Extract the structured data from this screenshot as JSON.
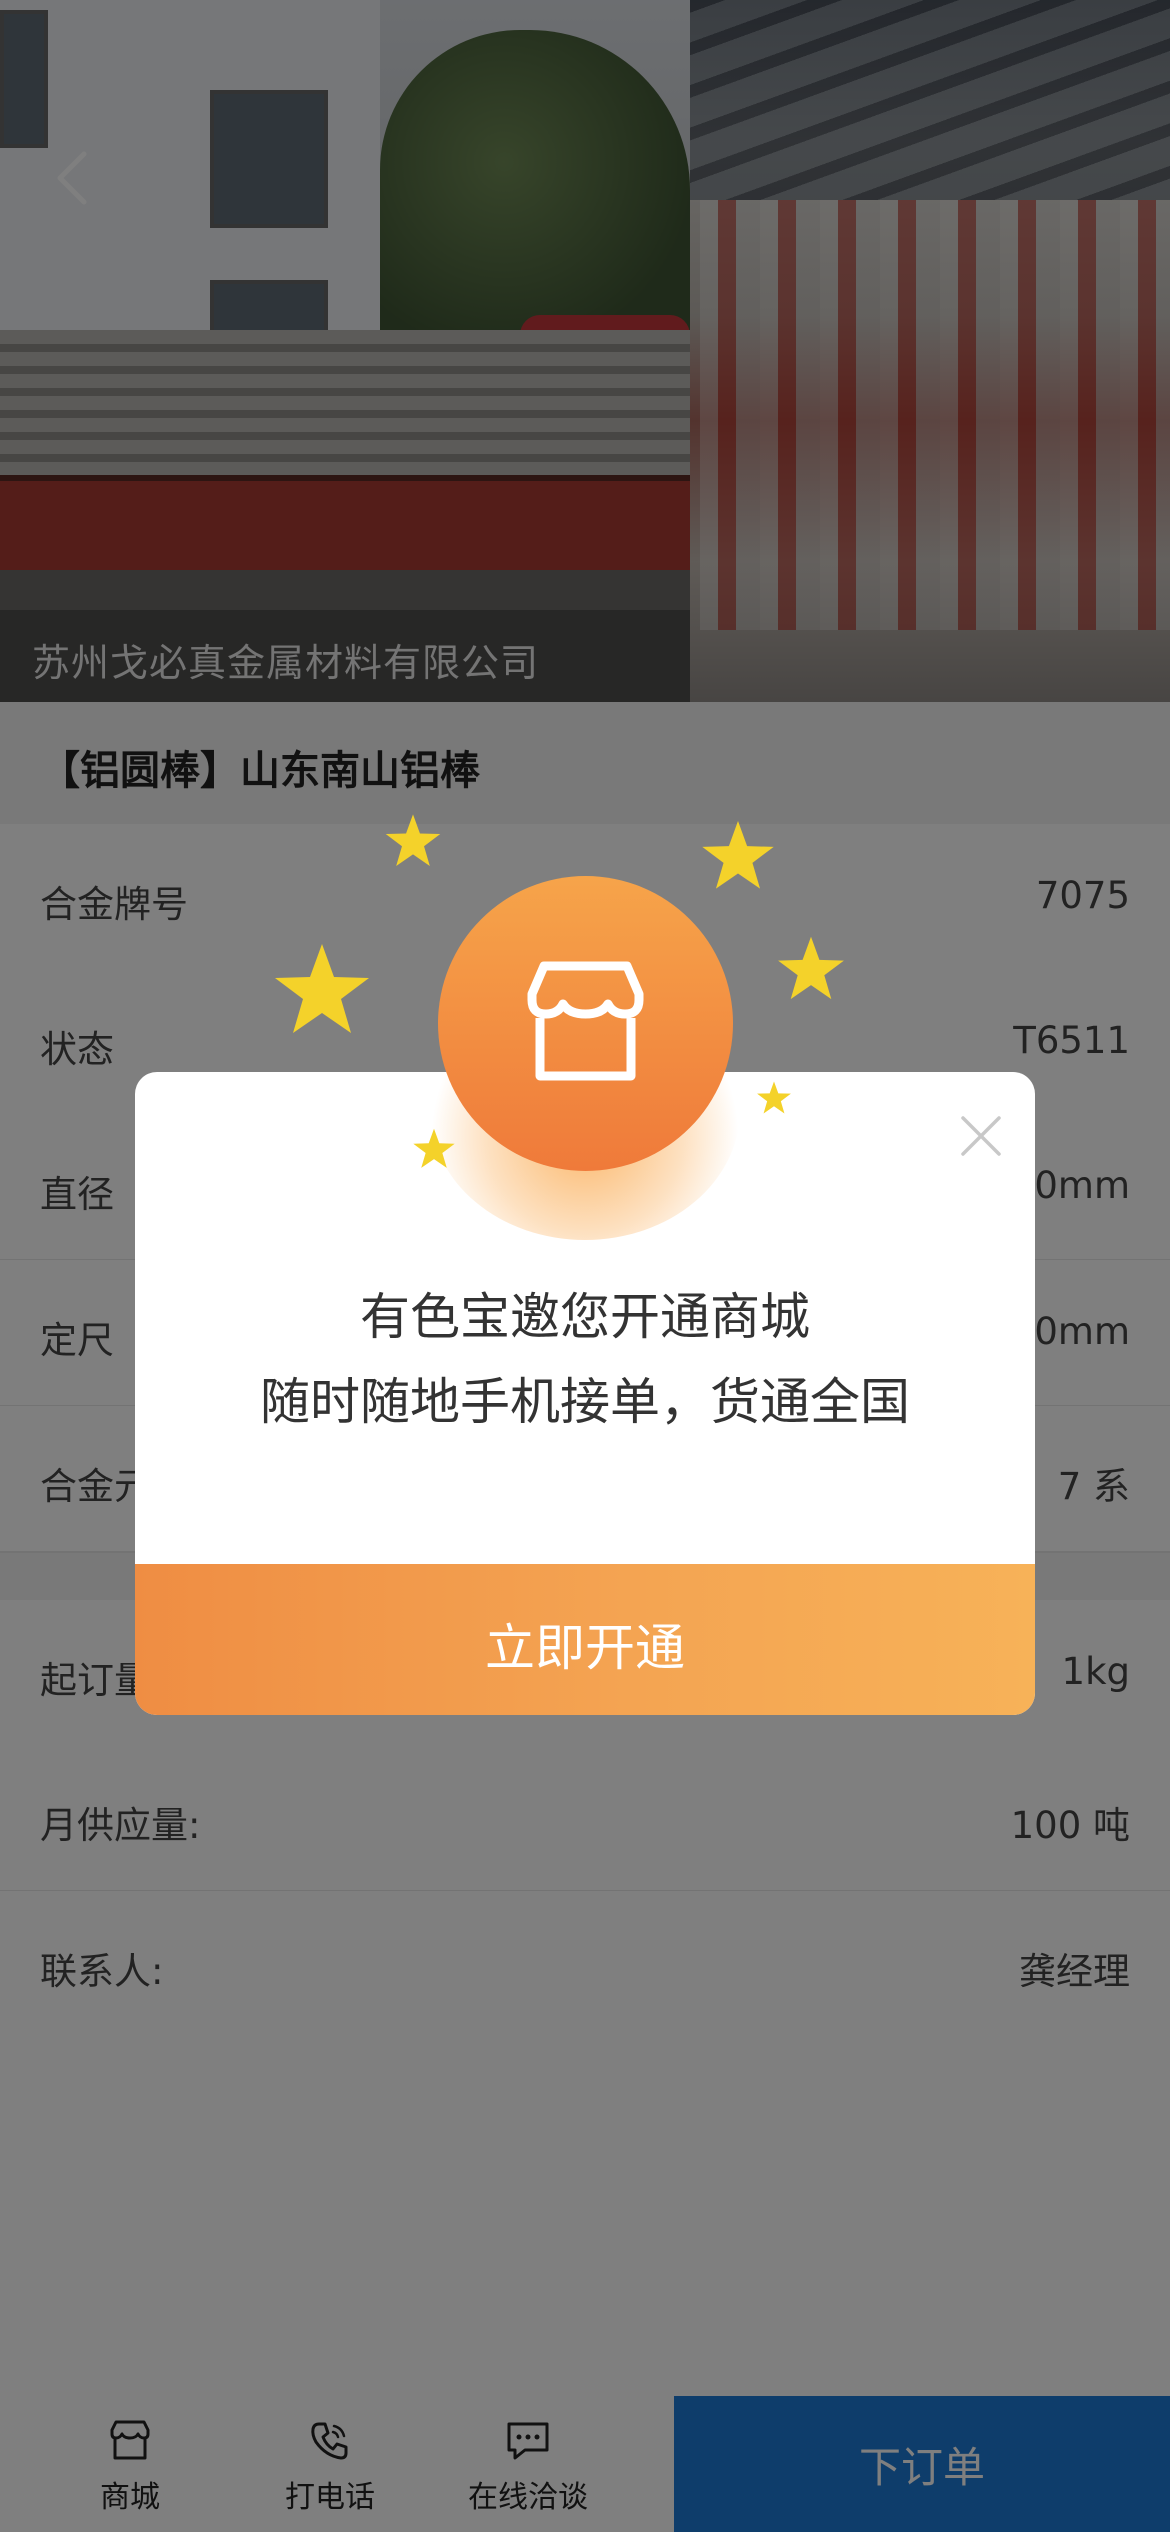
{
  "hero": {
    "company_name": "苏州戈必真金属材料有限公司"
  },
  "product": {
    "title": "【铝圆棒】山东南山铝棒"
  },
  "specs": [
    {
      "key": "合金牌号",
      "value": "7075"
    },
    {
      "key": "状态",
      "value": "T6511"
    },
    {
      "key": "直径",
      "value": ".0mm"
    },
    {
      "key": "定尺",
      "value": ".0mm"
    },
    {
      "key": "合金元",
      "value": "7 系"
    }
  ],
  "specs2": [
    {
      "key": "起订量",
      "value": "1kg"
    },
    {
      "key": "月供应量:",
      "value": "100 吨"
    },
    {
      "key": "联系人:",
      "value": "龚经理"
    }
  ],
  "bottom_bar": {
    "tabs": [
      {
        "label": "商城",
        "icon": "store-icon"
      },
      {
        "label": "打电话",
        "icon": "phone-icon"
      },
      {
        "label": "在线洽谈",
        "icon": "chat-icon"
      }
    ],
    "order_label": "下订单"
  },
  "modal": {
    "line1": "有色宝邀您开通商城",
    "line2": "随时随地手机接单，货通全国",
    "cta_label": "立即开通",
    "badge_icon": "store-icon",
    "close_icon": "close-icon"
  },
  "colors": {
    "accent_orange": "#f29a48",
    "order_blue": "#1d7bd6",
    "star_yellow": "#f4d22a"
  }
}
